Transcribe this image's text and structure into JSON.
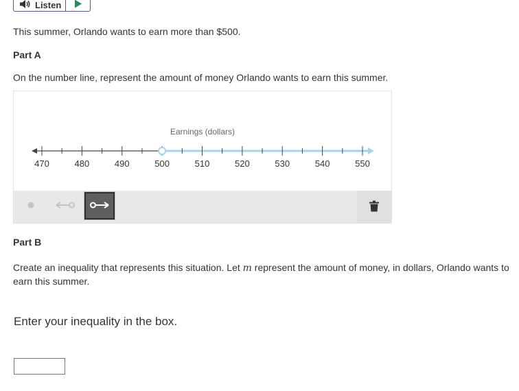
{
  "listen": {
    "label": "Listen"
  },
  "intro": "This summer, Orlando wants to earn more than $500.",
  "part_a": {
    "heading": "Part A",
    "prompt": "On the number line, represent the amount of money Orlando wants to earn this summer."
  },
  "number_line": {
    "title": "Earnings (dollars)",
    "ticks": [
      "470",
      "480",
      "490",
      "500",
      "510",
      "520",
      "530",
      "540",
      "550"
    ],
    "min": 470,
    "max": 550,
    "minor_step": 5,
    "ray_start": 500,
    "ray_open": true,
    "ray_direction": "right",
    "ray_color": "#a7d3ee",
    "axis_color": "#444444"
  },
  "toolbar": {
    "tools": [
      "point-tool",
      "left-ray-tool",
      "right-ray-tool"
    ],
    "selected": "right-ray-tool"
  },
  "part_b": {
    "heading": "Part B",
    "prompt_before": "Create an inequality that represents this situation.  Let ",
    "variable": "m",
    "prompt_after": " represent the amount of money, in dollars, Orlando wants to earn this summer."
  },
  "answer": {
    "instruction": "Enter your inequality in the box.",
    "value": ""
  }
}
